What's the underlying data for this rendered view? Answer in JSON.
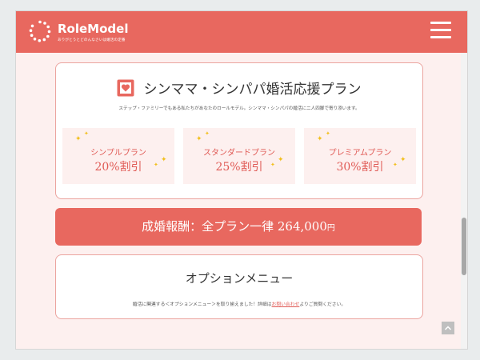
{
  "header": {
    "logo_text": "RoleModel",
    "tagline": "ありがとうとどのんなさいは婚活の定番",
    "menu_icon": "hamburger-icon",
    "color": "#e8685f"
  },
  "plan_section": {
    "title": "シンママ・シンパパ婚活応援プラン",
    "icon": "heart-icon",
    "description": "ステップ・ファミリーでもある私たちがあなたのロールモデル。シンママ・シンパパの婚活に二人四脚で寄り添います。",
    "plans": [
      {
        "name": "シンプルプラン",
        "discount": "20%割引"
      },
      {
        "name": "スタンダードプラン",
        "discount": "25%割引"
      },
      {
        "name": "プレミアムプラン",
        "discount": "30%割引"
      }
    ]
  },
  "price_bar": {
    "text": "成婚報酬：全プラン一律 264,000",
    "unit": "円"
  },
  "option_section": {
    "title": "オプションメニュー",
    "desc_before": "婚活に関連する＜オプションメニュー＞を取り揃えました！詳細は",
    "link_text": "お問い合わせ",
    "desc_after": "よりご質問ください。"
  },
  "scroll_to_top_icon": "chevron-up-icon"
}
